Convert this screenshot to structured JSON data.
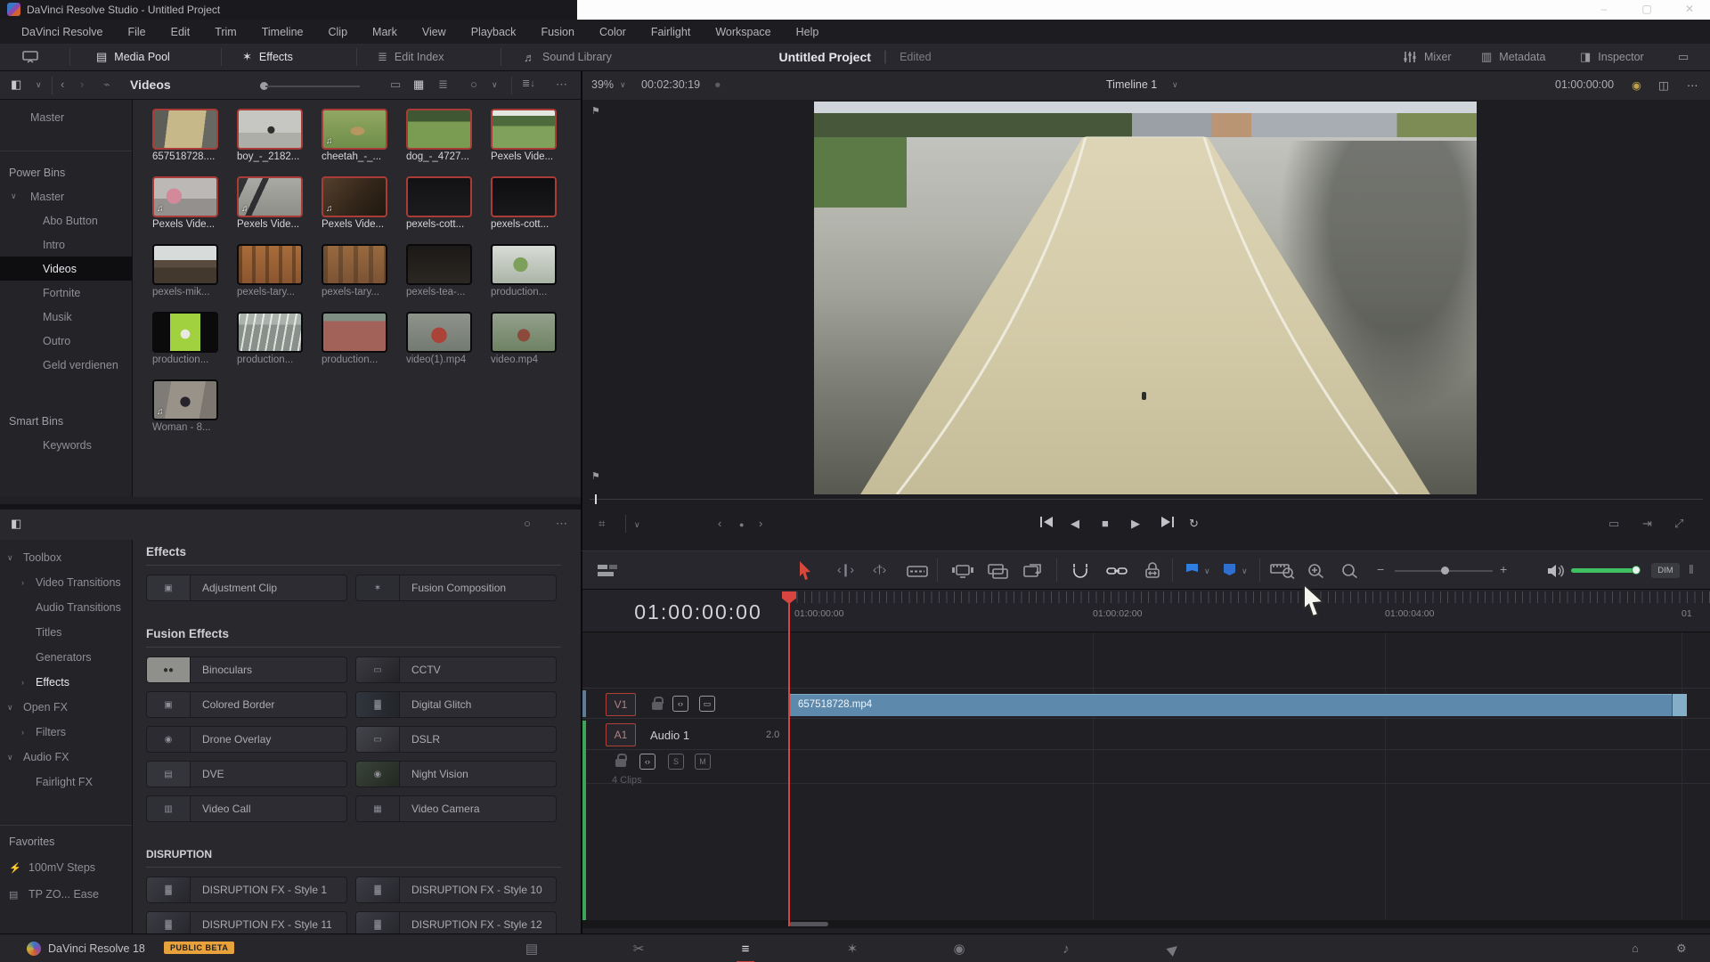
{
  "window": {
    "title": "DaVinci Resolve Studio - Untitled Project",
    "minimize": "–",
    "maximize": "▢",
    "close": "✕"
  },
  "menus": [
    "DaVinci Resolve",
    "File",
    "Edit",
    "Trim",
    "Timeline",
    "Clip",
    "Mark",
    "View",
    "Playback",
    "Fusion",
    "Color",
    "Fairlight",
    "Workspace",
    "Help"
  ],
  "topbar": {
    "media_pool": "Media Pool",
    "effects": "Effects",
    "edit_index": "Edit Index",
    "sound_library": "Sound Library",
    "project_title": "Untitled Project",
    "project_divider": "|",
    "project_status": "Edited",
    "mixer": "Mixer",
    "metadata": "Metadata",
    "inspector": "Inspector"
  },
  "media_pool": {
    "current_bin": "Videos",
    "bins": [
      {
        "label": "Master",
        "type": "top"
      },
      {
        "type": "divider",
        "label": ""
      },
      {
        "label": "Power Bins",
        "type": "section"
      },
      {
        "label": "Master",
        "type": "root",
        "chevron": "∨"
      },
      {
        "label": "Abo Button",
        "type": "child"
      },
      {
        "label": "Intro",
        "type": "child"
      },
      {
        "label": "Videos",
        "type": "child",
        "selected": true
      },
      {
        "label": "Fortnite",
        "type": "child"
      },
      {
        "label": "Musik",
        "type": "child"
      },
      {
        "label": "Outro",
        "type": "child"
      },
      {
        "label": "Geld verdienen",
        "type": "child"
      },
      {
        "label": "Smart Bins",
        "type": "section2"
      },
      {
        "label": "Keywords",
        "type": "child"
      }
    ],
    "items": [
      {
        "name": "657518728....",
        "selected": true,
        "bg": "background:linear-gradient(97deg,#5e5e58 0 22%,#c7b88a 22% 78%,#686862 78%)"
      },
      {
        "name": "boy_-_2182...",
        "selected": true,
        "bg": "background:radial-gradient(circle at 52% 52%,#2e2e2c 0 9%,rgba(0,0,0,0) 10%),linear-gradient(180deg,#c6c6c2 0 60%,#aeaea8 60%)"
      },
      {
        "name": "cheetah_-_...",
        "selected": true,
        "audio": true,
        "bg": "background:radial-gradient(ellipse at 55% 55%,#b5975f 0 14%,rgba(0,0,0,0) 15%),linear-gradient(180deg,#91a763,#6f8f4a)"
      },
      {
        "name": "dog_-_4727...",
        "selected": true,
        "bg": "background:linear-gradient(180deg,#3f5733 0 30%,#7a9b52 30%)"
      },
      {
        "name": "Pexels Vide...",
        "selected": true,
        "bg": "background:linear-gradient(180deg,#e3e7e2 0 14%,#4c6a3c 14% 42%,#80a15c 42%)"
      },
      {
        "name": "Pexels Vide...",
        "selected": true,
        "audio": true,
        "bg": "background:radial-gradient(circle at 32% 48%,#d2899a 0 16%,rgba(0,0,0,0) 17%),linear-gradient(180deg,#bcb8b6 0 55%,#93908d 55%)"
      },
      {
        "name": "Pexels Vide...",
        "selected": true,
        "audio": true,
        "bg": "background:linear-gradient(115deg,rgba(30,30,32,.85) 12%,rgba(0,0,0,0) 12% 30%,rgba(35,35,38,.9) 30% 38%,rgba(0,0,0,0) 38%),linear-gradient(180deg,#a9a9a5,#8f8f89)"
      },
      {
        "name": "Pexels Vide...",
        "selected": true,
        "audio": true,
        "bg": "background:linear-gradient(130deg,#54402c,#33261a 55%,#20180f)"
      },
      {
        "name": "pexels-cott...",
        "selected": true,
        "bg": "background:linear-gradient(180deg,#121214,#1c1c1f)"
      },
      {
        "name": "pexels-cott...",
        "selected": true,
        "bg": "background:linear-gradient(180deg,#0e0e10,#19191c)"
      },
      {
        "name": "pexels-mik...",
        "bg": "background:linear-gradient(180deg,#d7dbda 0 38%,#584a3e 38% 58%,#42382e 58%)"
      },
      {
        "name": "pexels-tary...",
        "bg": "background:repeating-linear-gradient(90deg,rgba(64,42,24,.5) 0 4px,rgba(0,0,0,0) 4px 15px),linear-gradient(180deg,#a96c3a,#8a5630)"
      },
      {
        "name": "pexels-tary...",
        "bg": "background:repeating-linear-gradient(90deg,rgba(70,50,32,.45) 0 5px,rgba(0,0,0,0) 5px 17px),linear-gradient(180deg,#97693f,#7c5434)"
      },
      {
        "name": "pexels-tea-...",
        "bg": "background:linear-gradient(180deg,#1b1917,#2b2722)"
      },
      {
        "name": "production...",
        "bg": "background:radial-gradient(circle at 45% 50%,#7da05a 0 18%,rgba(0,0,0,0) 19%),linear-gradient(180deg,#d8dcd6,#aab4a6)"
      },
      {
        "name": "production...",
        "bg": "background:radial-gradient(circle at 50% 55%,#e9e9e4 0 12%,rgba(0,0,0,0) 13%),linear-gradient(90deg,#0b0b0b 0 26%,#a2d13f 26% 74%,#0b0b0b 74%)"
      },
      {
        "name": "production...",
        "bg": "background:repeating-linear-gradient(100deg,rgba(245,245,240,.8) 0 2px,rgba(0,0,0,0) 2px 9px),linear-gradient(180deg,#a9b2ac 0 30%,#87908a 30%)"
      },
      {
        "name": "production...",
        "bg": "background:linear-gradient(180deg,#7f8e83 0 20%,#a2625a 20%)"
      },
      {
        "name": "video(1).mp4",
        "bg": "background:radial-gradient(circle at 50% 58%,#ab4338 0 20%,rgba(0,0,0,0) 21%),linear-gradient(180deg,#8f948b,#737a70)"
      },
      {
        "name": "video.mp4",
        "bg": "background:radial-gradient(circle at 50% 58%,#8c4a3c 0 16%,rgba(0,0,0,0) 17%),linear-gradient(180deg,#93a08c,#6f8263)"
      },
      {
        "name": "Woman - 8...",
        "audio": true,
        "bg": "background:radial-gradient(circle at 50% 55%,#26242a 0 13%,rgba(0,0,0,0) 14%),linear-gradient(100deg,#7f7b76 0 25%,#989289 25% 75%,#7b766f 75%)"
      }
    ]
  },
  "effects": {
    "toolbox": [
      {
        "label": "Toolbox",
        "type": "root",
        "chevron": "∨"
      },
      {
        "label": "Video Transitions",
        "type": "child",
        "chevron": "›"
      },
      {
        "label": "Audio Transitions",
        "type": "child"
      },
      {
        "label": "Titles",
        "type": "child"
      },
      {
        "label": "Generators",
        "type": "child"
      },
      {
        "label": "Effects",
        "type": "child",
        "chevron": "›",
        "selected": true
      },
      {
        "label": "Open FX",
        "type": "root",
        "chevron": "∨"
      },
      {
        "label": "Filters",
        "type": "child",
        "chevron": "›"
      },
      {
        "label": "Audio FX",
        "type": "root",
        "chevron": "∨"
      },
      {
        "label": "Fairlight FX",
        "type": "child"
      },
      {
        "label": "Favorites",
        "type": "section"
      },
      {
        "label": "100mV Steps",
        "type": "fav",
        "icon": "⚡"
      },
      {
        "label": "TP ZO... Ease",
        "type": "fav",
        "icon": "▤"
      }
    ],
    "section1": {
      "title": "Effects",
      "items": [
        {
          "label": "Adjustment Clip",
          "glyph": "▣",
          "tile": "background:#323239"
        },
        {
          "label": "Fusion Composition",
          "glyph": "✶",
          "tile": "background:#2c2c33"
        }
      ]
    },
    "section2": {
      "title": "Fusion Effects",
      "items": [
        {
          "label": "Binoculars",
          "glyph": "●●",
          "tile": "background:#8f8f8c;color:#2e2e31"
        },
        {
          "label": "CCTV",
          "glyph": "▭",
          "tile": "background:linear-gradient(135deg,#3a3a40,#232327)"
        },
        {
          "label": "Colored Border",
          "glyph": "▣",
          "tile": "background:#2e2e34"
        },
        {
          "label": "Digital Glitch",
          "glyph": "▓",
          "tile": "background:linear-gradient(90deg,#30343c,#23252a)"
        },
        {
          "label": "Drone Overlay",
          "glyph": "◉",
          "tile": "background:#2b2b31"
        },
        {
          "label": "DSLR",
          "glyph": "▭",
          "tile": "background:linear-gradient(135deg,#44444b,#2a2a30)"
        },
        {
          "label": "DVE",
          "glyph": "▤",
          "tile": "background:#34343b"
        },
        {
          "label": "Night Vision",
          "glyph": "◉",
          "tile": "background:linear-gradient(135deg,#394439,#222822)"
        },
        {
          "label": "Video Call",
          "glyph": "▥",
          "tile": "background:#2e3036"
        },
        {
          "label": "Video Camera",
          "glyph": "▦",
          "tile": "background:#2b2b31"
        }
      ]
    },
    "section3": {
      "title": "DISRUPTION",
      "items": [
        {
          "label": "DISRUPTION FX - Style 1",
          "glyph": "▓",
          "tile": "background:linear-gradient(135deg,#3c3c44,#26262c)"
        },
        {
          "label": "DISRUPTION FX - Style 10",
          "glyph": "▓",
          "tile": "background:linear-gradient(135deg,#3c3c44,#26262c)"
        },
        {
          "label": "DISRUPTION FX - Style 11",
          "glyph": "▓",
          "tile": "background:linear-gradient(135deg,#3c3c44,#26262c)"
        },
        {
          "label": "DISRUPTION FX - Style 12",
          "glyph": "▓",
          "tile": "background:linear-gradient(135deg,#3c3c44,#26262c)"
        }
      ]
    }
  },
  "viewer": {
    "zoom_level": "39%",
    "clip_timecode": "00:02:30:19",
    "timeline_name": "Timeline 1",
    "timeline_timecode": "01:00:00:00"
  },
  "timeline": {
    "playhead_timecode": "01:00:00:00",
    "ruler_labels": [
      {
        "text": "01:00:00:00",
        "pos": "left:238px"
      },
      {
        "text": "01:00:02:00",
        "pos": "left:573px"
      },
      {
        "text": "01:00:04:00",
        "pos": "left:901px"
      },
      {
        "text": "01",
        "pos": "left:1234px"
      }
    ],
    "video_track_id": "V1",
    "audio_track_id": "A1",
    "audio_track_name": "Audio 1",
    "audio_format": "2.0",
    "audio_clip_count": "4 Clips",
    "solo": "S",
    "mute": "M",
    "clip_name": "657518728.mp4",
    "dim_button": "DIM"
  },
  "statusbar": {
    "app_name": "DaVinci Resolve 18",
    "badge": "PUBLIC BETA",
    "pages": [
      {
        "id": "media",
        "glyph": "▤"
      },
      {
        "id": "cut",
        "glyph": "✂"
      },
      {
        "id": "edit",
        "glyph": "≡",
        "active": true
      },
      {
        "id": "fusion",
        "glyph": "✶"
      },
      {
        "id": "color",
        "glyph": "◉"
      },
      {
        "id": "fairlight",
        "glyph": "♪"
      },
      {
        "id": "deliver",
        "glyph": "▶",
        "rot": true
      }
    ]
  },
  "colors": {
    "accent_red": "#c9413e",
    "clip_blue": "#5d89ac",
    "flag_blue": "#2f7fe0",
    "meter_green": "#3fa457",
    "volume_green": "#3fc061",
    "beta_orange": "#e9a13b"
  }
}
